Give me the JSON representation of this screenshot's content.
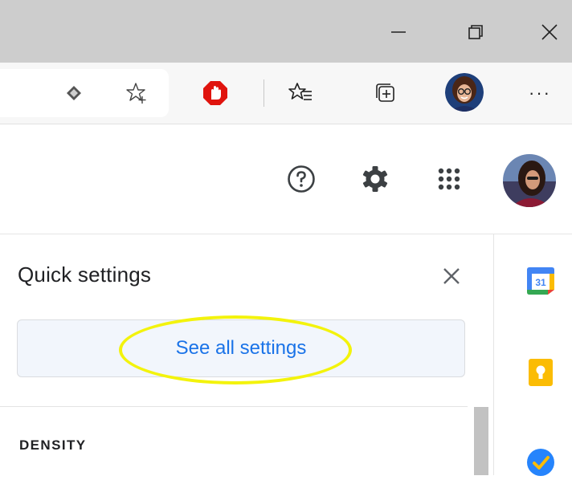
{
  "window": {
    "minimize_icon": "minimize-icon",
    "restore_icon": "restore-icon",
    "close_icon": "close-icon"
  },
  "toolbar": {
    "icons": [
      "immersive-reader-icon",
      "add-favorite-icon",
      "adblock-stop-icon",
      "favorites-icon",
      "collections-icon",
      "profile-avatar",
      "more-icon"
    ],
    "more_label": "···"
  },
  "gmail_header": {
    "icons": [
      "help-icon",
      "settings-gear-icon",
      "apps-grid-icon",
      "account-avatar"
    ]
  },
  "quick_settings": {
    "title": "Quick settings",
    "see_all_label": "See all settings",
    "density_label": "DENSITY"
  },
  "side_panel": {
    "apps": [
      "google-calendar-icon",
      "google-keep-icon",
      "google-tasks-icon"
    ],
    "calendar_day": "31"
  },
  "colors": {
    "titlebar_bg": "#cdcdcd",
    "toolbar_bg": "#f7f7f7",
    "link_blue": "#1a73e8",
    "highlight_yellow": "#f3f30c",
    "adblock_red": "#e0140e"
  }
}
